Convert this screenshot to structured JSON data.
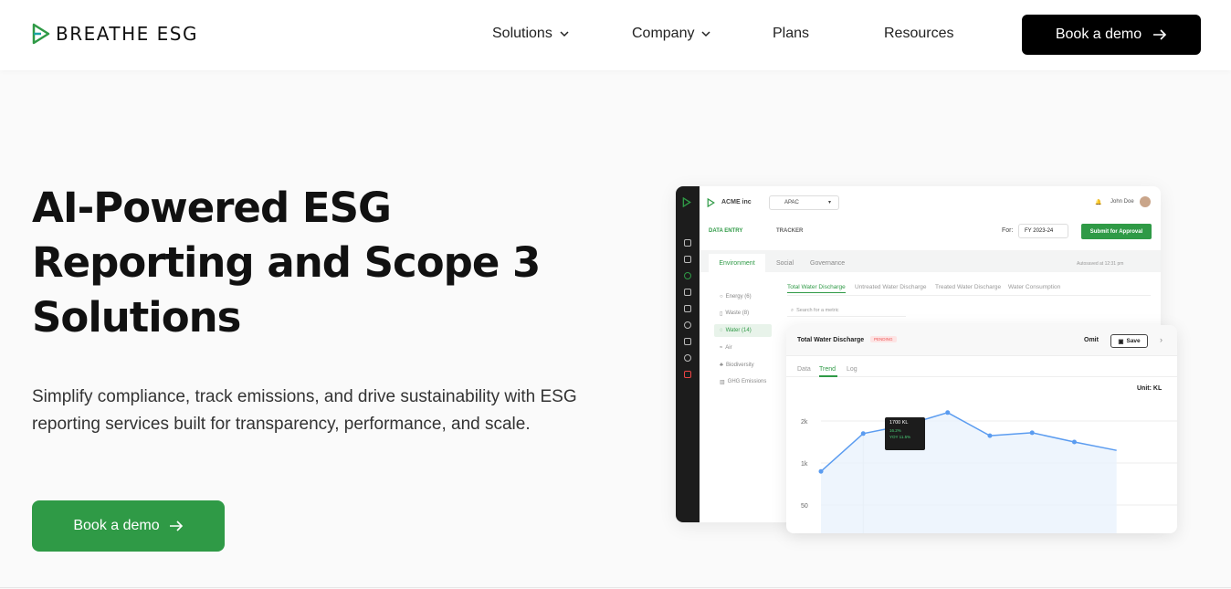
{
  "header": {
    "brand": "BREATHE ESG",
    "nav": [
      {
        "label": "Solutions",
        "dropdown": true
      },
      {
        "label": "Company",
        "dropdown": true
      },
      {
        "label": "Plans",
        "dropdown": false
      },
      {
        "label": "Resources",
        "dropdown": false
      }
    ],
    "cta": "Book a demo"
  },
  "hero": {
    "title": "AI-Powered ESG Reporting and Scope 3 Solutions",
    "subtitle": "Simplify compliance, track emissions, and drive sustainability with ESG reporting services built for transparency, performance, and scale.",
    "cta": "Book a demo"
  },
  "dashboard": {
    "company": "ACME inc",
    "region": "APAC",
    "user": "John Doe",
    "nav_tabs": [
      "DATA ENTRY",
      "TRACKER"
    ],
    "for_label": "For:",
    "fiscal_year": "FY 2023-24",
    "submit": "Submit for Approval",
    "category_tabs": [
      "Environment",
      "Social",
      "Governance"
    ],
    "autosave": "Autosaved at 12:31 pm",
    "side_items": [
      "Energy (6)",
      "Waste (8)",
      "Water (14)",
      "Air",
      "Biodiversity",
      "GHG Emissions"
    ],
    "sub_tabs": [
      "Total Water Discharge",
      "Untreated Water Discharge",
      "Treated Water Discharge",
      "Water Consumption"
    ],
    "search_placeholder": "Search for a metric"
  },
  "card": {
    "title": "Total Water Discharge",
    "status": "PENDING",
    "omit": "Omit",
    "save": "Save",
    "tabs": [
      "Data",
      "Trend",
      "Log"
    ],
    "unit": "Unit: KL",
    "tooltip_value": "1700 KL",
    "tooltip_line1": "16.2%",
    "tooltip_line2": "YOY  11.5%"
  },
  "chart_data": {
    "type": "line",
    "yticks": [
      "2k",
      "1k",
      "50"
    ],
    "values": [
      800,
      1700,
      1900,
      2200,
      1650,
      1720,
      1500,
      1300
    ],
    "ylim": [
      0,
      2500
    ]
  },
  "colors": {
    "accent": "#2f9a46",
    "dark": "#000000",
    "chart": "#5b9cf0"
  }
}
